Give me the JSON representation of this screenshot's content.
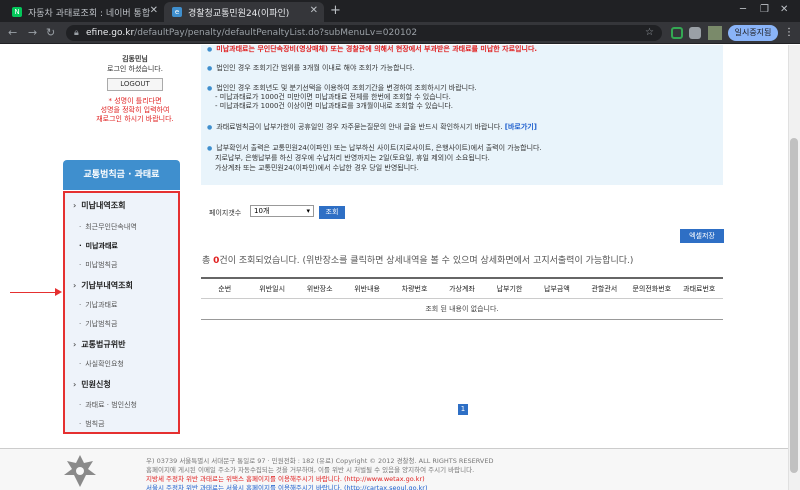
{
  "browser": {
    "tabs": [
      {
        "label": "자동차 과태료조회 : 네이버 통합",
        "favicon": "N",
        "favicon_color": "#03c75a"
      },
      {
        "label": "경찰청교통민원24(이파인)",
        "favicon": "e",
        "favicon_color": "#3f8fce"
      }
    ],
    "new_tab": "+",
    "url_domain": "efine.go.kr",
    "url_path": "/defaultPay/penalty/defaultPenaltyList.do?subMenuLv=020102",
    "promo_label": "일시중지됨"
  },
  "login": {
    "name": "김동민님",
    "status": "로그인 하셨습니다.",
    "logout_label": "LOGOUT",
    "error_1": "* 성명이 틀리다면",
    "error_2": "성명을 정확히 입력하여",
    "error_3": "재로그인 하시기 바랍니다."
  },
  "sidebar": {
    "title": "교통범칙금 · 과태료",
    "items": [
      {
        "label": "미납내역조회",
        "level": 1
      },
      {
        "label": "최근무인단속내역",
        "level": 2
      },
      {
        "label": "미납과태료",
        "level": 2,
        "selected": true
      },
      {
        "label": "미납범칙금",
        "level": 2
      },
      {
        "label": "기납부내역조회",
        "level": 1
      },
      {
        "label": "기납과태료",
        "level": 2
      },
      {
        "label": "기납범칙금",
        "level": 2
      },
      {
        "label": "교통법규위반",
        "level": 1
      },
      {
        "label": "사실확인요청",
        "level": 2
      },
      {
        "label": "민원신청",
        "level": 1
      },
      {
        "label": "과태료 · 범인신청",
        "level": 2
      },
      {
        "label": "범칙금",
        "level": 2
      }
    ]
  },
  "info": {
    "line_top": "미납과태료는 무인단속장비(영상매체) 또는 경찰관에 의해서 현장에서 부과받은 과태료를 미납한 자료입니다.",
    "line_1": "법인인 경우 조회기간 범위를 3개월 이내로 해야 조회가 가능합니다.",
    "line_2": "법인인 경우 조회년도 및 분기선택을 이용하여 조회기간을 변경하여 조회하시기 바랍니다.",
    "line_2a": "- 미납과태료가 1000건 미만이면 미납과태료 전체를 한번에 조회할 수 있습니다.",
    "line_2b": "- 미납과태료가 1000건 이상이면 미납과태료를 3개월이내로 조회할 수 있습니다.",
    "line_3": "과태료범칙금이 납부가한이 공휴일인 경우 자주묻는질문의 안내 글을 반드시 확인하시기 바랍니다.",
    "line_3_link": "[바로가기]",
    "line_4": "납부확인서 출력은 교통민원24(이파인) 또는 납부하신 사이트(지로사이트, 은행사이트)에서 출력이 가능합니다.",
    "line_4a": "지로납부, 은행납부를 하신 경우에 수납처리 반영까지는 2일(토요일, 휴일 제외)이 소요됩니다.",
    "line_4b": "가상계좌 또는 교통민원24(이파인)에서 수납한 경우 당일 반영됩니다."
  },
  "controls": {
    "page_count_label": "페이지갯수",
    "page_count_value": "10개",
    "lookup_label": "조회",
    "excel_label": "엑셀저장"
  },
  "summary": {
    "prefix": "총",
    "count": "0",
    "suffix": "건이 조회되었습니다. (위반장소를 클릭하면 상세내역을 볼 수 있으며 상세화면에서 고지서출력이 가능합니다.)"
  },
  "table": {
    "headers": [
      "순번",
      "위반일시",
      "위반장소",
      "위반내용",
      "차량번호",
      "가상계좌",
      "납부기한",
      "납부금액",
      "관할관서",
      "문의전화번호",
      "과태료번호"
    ],
    "empty_message": "조회 된 내용이 없습니다."
  },
  "pagination": {
    "current": "1"
  },
  "footer": {
    "line_1": "우) 03739 서울특별시 서대문구 통일로 97 · 민원전화 : 182 (유료)        Copyright © 2012 경찰청. ALL RIGHTS RESERVED",
    "line_2": "홈페이지에 게시된 이메일 주소가 자동수집되는 것을 거부하며, 이를 위반 시 처벌될 수 있음을 양지하여 주시기 바랍니다.",
    "line_3": "지방세 주정차 위반 과태료는 위택스 홈페이지를 이용해주시기 바랍니다. (http://www.wetax.go.kr)",
    "line_4": "서울시 주정차 위반 과태료는 서울시 홈페이지를 이용해주시기 바랍니다. (http://cartax.seoul.go.kr)"
  }
}
